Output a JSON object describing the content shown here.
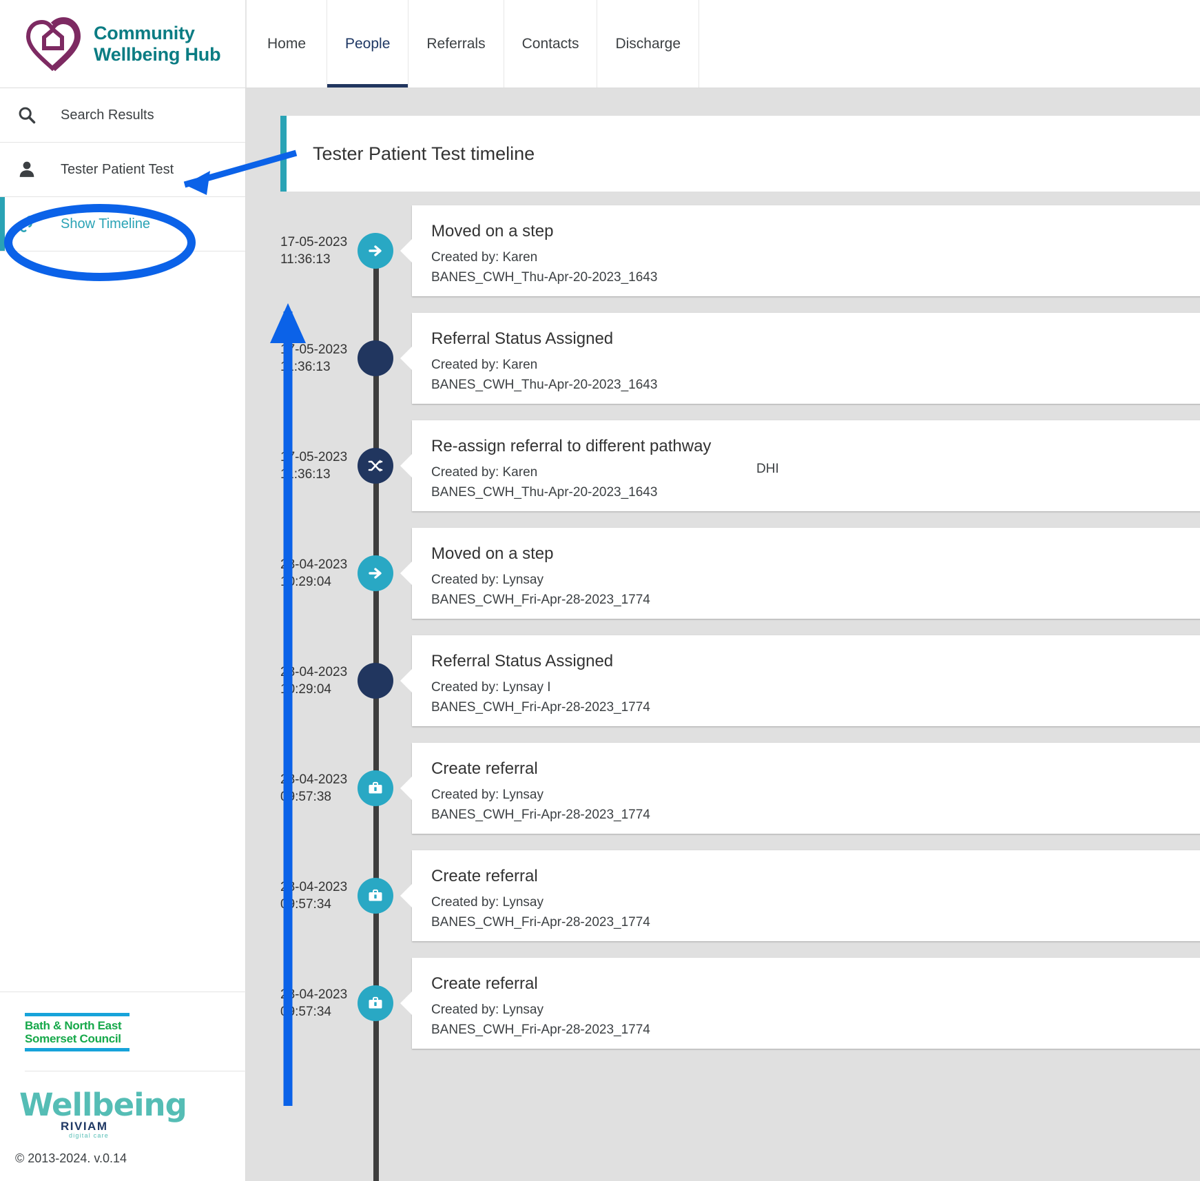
{
  "brand": {
    "line1": "Community",
    "line2": "Wellbeing Hub",
    "logo_icon": "heart-house-icon"
  },
  "nav": {
    "tabs": [
      {
        "label": "Home",
        "active": false
      },
      {
        "label": "People",
        "active": true
      },
      {
        "label": "Referrals",
        "active": false
      },
      {
        "label": "Contacts",
        "active": false
      },
      {
        "label": "Discharge",
        "active": false
      }
    ]
  },
  "sidebar": {
    "items": [
      {
        "label": "Search Results",
        "icon": "search-icon",
        "active": false
      },
      {
        "label": "Tester Patient Test",
        "icon": "person-icon",
        "active": false
      },
      {
        "label": "Show Timeline",
        "icon": "link-chain-icon",
        "active": true
      }
    ],
    "footer": {
      "council_line1": "Bath & North East",
      "council_line2": "Somerset Council",
      "wellbeing_word": "Wellbeing",
      "riviam": "RIVIAM",
      "riviam_sub": "digital care",
      "copyright": "© 2013-2024. v.0.14"
    }
  },
  "timeline": {
    "header_title": "Tester Patient Test timeline",
    "entries": [
      {
        "date": "17-05-2023",
        "time": "11:36:13",
        "title": "Moved on a step",
        "created_by": "Created by: Karen",
        "reference": "BANES_CWH_Thu-Apr-20-2023_1643",
        "extra": "",
        "marker_style": "teal",
        "marker_icon": "arrow-right-icon"
      },
      {
        "date": "17-05-2023",
        "time": "11:36:13",
        "title": "Referral Status Assigned",
        "created_by": "Created by: Karen",
        "reference": "BANES_CWH_Thu-Apr-20-2023_1643",
        "extra": "",
        "marker_style": "navy",
        "marker_icon": "dot-icon"
      },
      {
        "date": "17-05-2023",
        "time": "11:36:13",
        "title": "Re-assign referral to different pathway",
        "created_by": "Created by: Karen",
        "reference": "BANES_CWH_Thu-Apr-20-2023_1643",
        "extra": "DHI",
        "marker_style": "navy",
        "marker_icon": "shuffle-icon"
      },
      {
        "date": "28-04-2023",
        "time": "10:29:04",
        "title": "Moved on a step",
        "created_by": "Created by: Lynsay",
        "reference": "BANES_CWH_Fri-Apr-28-2023_1774",
        "extra": "",
        "marker_style": "teal",
        "marker_icon": "arrow-right-icon"
      },
      {
        "date": "28-04-2023",
        "time": "10:29:04",
        "title": "Referral Status Assigned",
        "created_by": "Created by: Lynsay I",
        "reference": "BANES_CWH_Fri-Apr-28-2023_1774",
        "extra": "",
        "marker_style": "navy",
        "marker_icon": "dot-icon"
      },
      {
        "date": "28-04-2023",
        "time": "09:57:38",
        "title": "Create referral",
        "created_by": "Created by: Lynsay",
        "reference": "BANES_CWH_Fri-Apr-28-2023_1774",
        "extra": "",
        "marker_style": "teal",
        "marker_icon": "briefcase-icon"
      },
      {
        "date": "28-04-2023",
        "time": "09:57:34",
        "title": "Create referral",
        "created_by": "Created by: Lynsay",
        "reference": "BANES_CWH_Fri-Apr-28-2023_1774",
        "extra": "",
        "marker_style": "teal",
        "marker_icon": "briefcase-icon"
      },
      {
        "date": "28-04-2023",
        "time": "09:57:34",
        "title": "Create referral",
        "created_by": "Created by: Lynsay",
        "reference": "BANES_CWH_Fri-Apr-28-2023_1774",
        "extra": "",
        "marker_style": "teal",
        "marker_icon": "briefcase-icon"
      }
    ]
  },
  "colors": {
    "brand_teal": "#0b7c83",
    "brand_purple": "#7d2a62",
    "accent_teal": "#2aa3b5",
    "marker_teal": "#29a8c4",
    "marker_navy": "#21365f",
    "tab_active": "#1f3864",
    "annotation_blue": "#0b62e8",
    "page_bg": "#e0e0e0",
    "council_green": "#16a84a",
    "council_blue": "#17a3da"
  }
}
